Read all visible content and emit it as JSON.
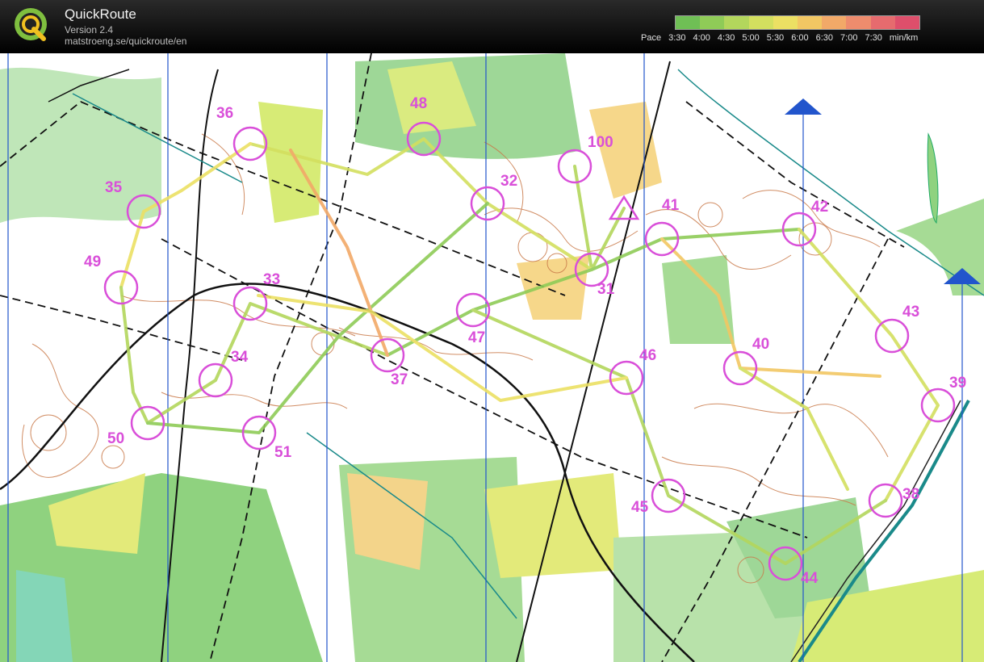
{
  "app": {
    "name": "QuickRoute",
    "version": "Version 2.4",
    "url": "matstroeng.se/quickroute/en",
    "logo_letter": "Q"
  },
  "pace_legend": {
    "label": "Pace",
    "ticks": [
      "3:30",
      "4:00",
      "4:30",
      "5:00",
      "5:30",
      "6:00",
      "6:30",
      "7:00",
      "7:30"
    ],
    "unit": "min/km",
    "gradient_colors": [
      "#6fbf55",
      "#8fcb57",
      "#b3d65c",
      "#d3df5f",
      "#ece063",
      "#f2c763",
      "#f2a968",
      "#ee8c6d",
      "#e66b6e",
      "#de4f6b"
    ]
  },
  "map": {
    "controls": [
      {
        "label": "36"
      },
      {
        "label": "48"
      },
      {
        "label": "100"
      },
      {
        "label": "35"
      },
      {
        "label": "32"
      },
      {
        "label": "41"
      },
      {
        "label": "42"
      },
      {
        "label": "49"
      },
      {
        "label": "33"
      },
      {
        "label": "31"
      },
      {
        "label": "43"
      },
      {
        "label": "47"
      },
      {
        "label": "40"
      },
      {
        "label": "34"
      },
      {
        "label": "37"
      },
      {
        "label": "46"
      },
      {
        "label": "39"
      },
      {
        "label": "50"
      },
      {
        "label": "51"
      },
      {
        "label": "45"
      },
      {
        "label": "38"
      },
      {
        "label": "44"
      }
    ]
  }
}
